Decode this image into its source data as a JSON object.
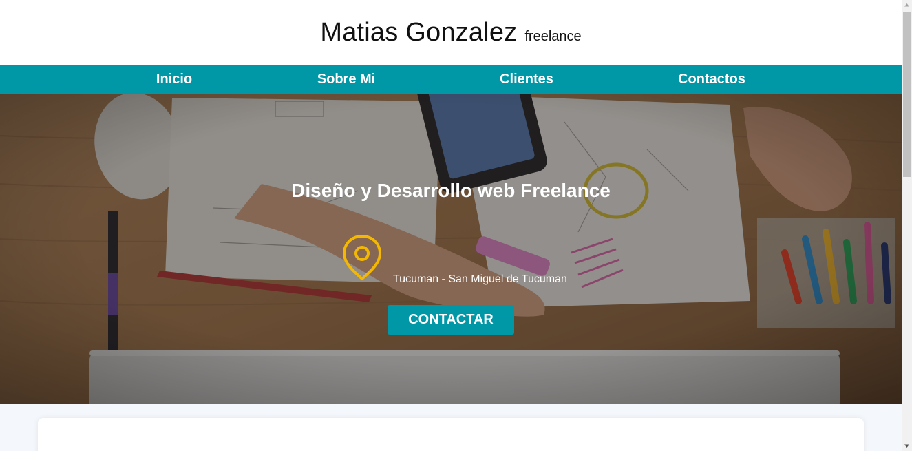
{
  "header": {
    "name": "Matias Gonzalez",
    "tagline": "freelance"
  },
  "nav": {
    "items": [
      {
        "label": "Inicio"
      },
      {
        "label": "Sobre Mi"
      },
      {
        "label": "Clientes"
      },
      {
        "label": "Contactos"
      }
    ]
  },
  "hero": {
    "title": "Diseño y Desarrollo web Freelance",
    "location": "Tucuman - San Miguel de Tucuman",
    "location_icon": "map-pin-icon",
    "cta_label": "CONTACTAR"
  },
  "colors": {
    "accent": "#0097a7",
    "pin": "#f5b800",
    "header_bg": "#ffffff",
    "page_bg": "#f4f7fb"
  }
}
